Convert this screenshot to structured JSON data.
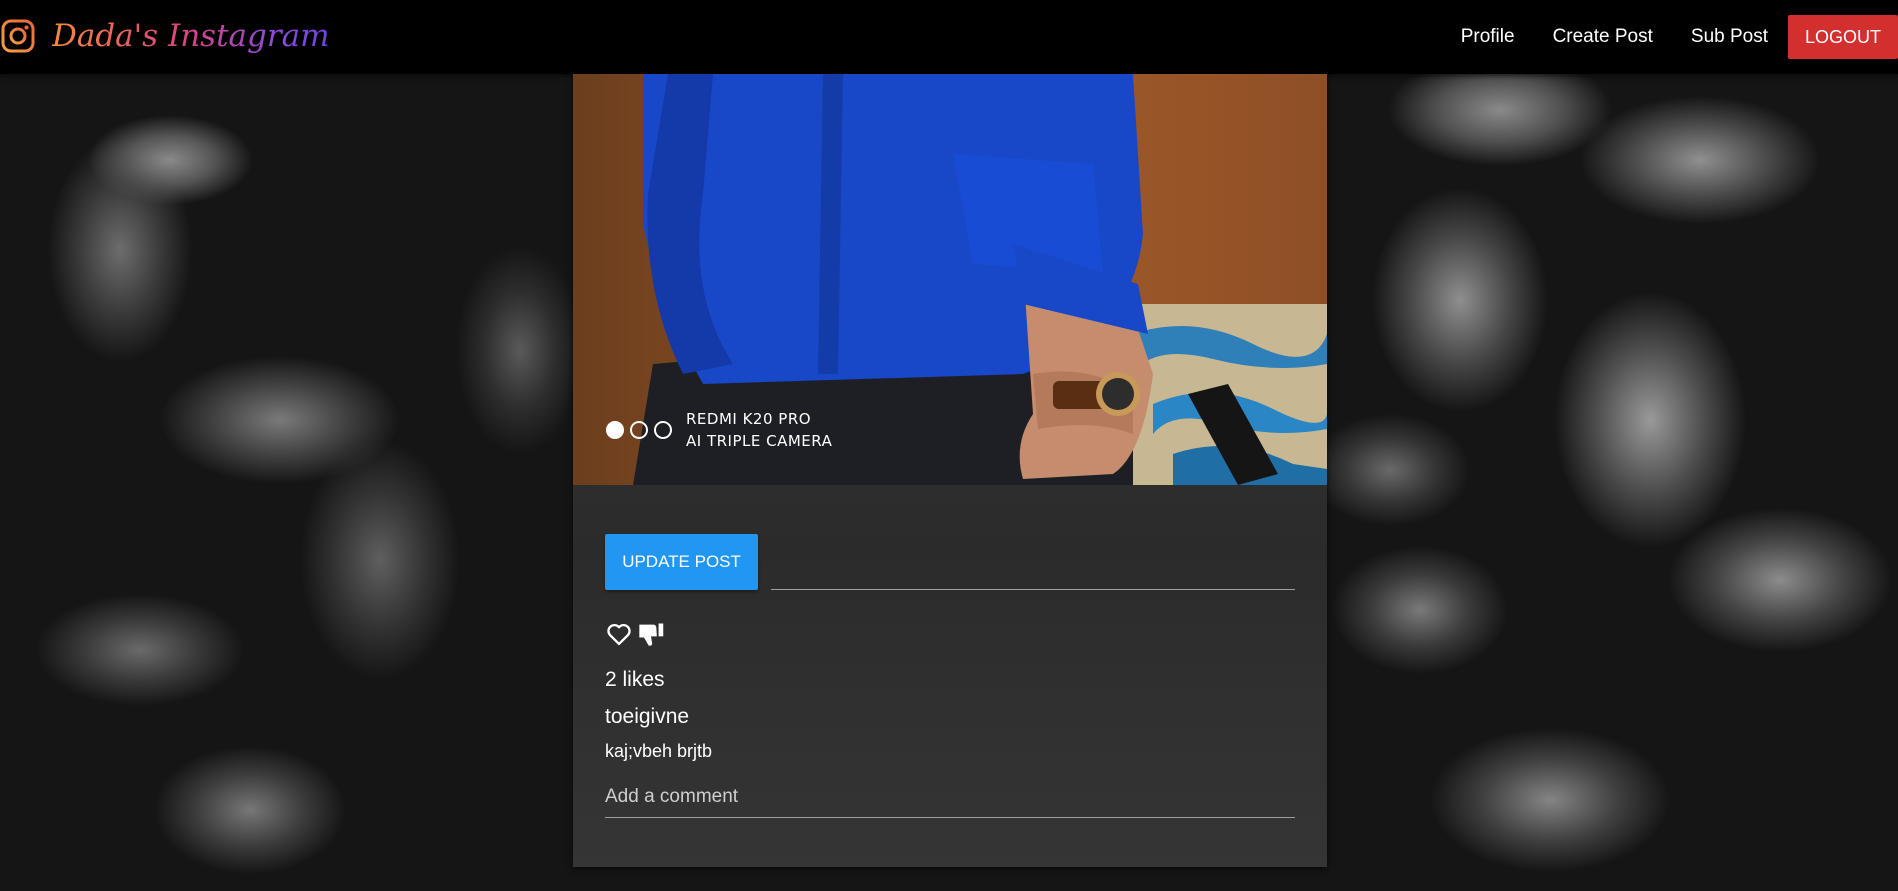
{
  "navbar": {
    "brand": "Dada's Instagram",
    "links": [
      "Profile",
      "Create Post",
      "Sub Post"
    ],
    "logout_label": "LOGOUT"
  },
  "post": {
    "photo_watermark": {
      "line1": "REDMI K20 PRO",
      "line2": "AI TRIPLE CAMERA"
    },
    "update_button_label": "UPDATE POST",
    "update_input_value": "",
    "likes_text": "2 likes",
    "title": "toeigivne",
    "body": "kaj;vbeh brjtb",
    "comment_placeholder": "Add a comment"
  },
  "icons": {
    "logo": "instagram-icon",
    "like": "heart-outline-icon",
    "dislike": "thumbs-down-icon"
  },
  "colors": {
    "logout": "#d32f2f",
    "update_button": "#2196f3",
    "brand_gradient_start": "#f58a3c",
    "brand_gradient_end": "#6a44e0"
  }
}
